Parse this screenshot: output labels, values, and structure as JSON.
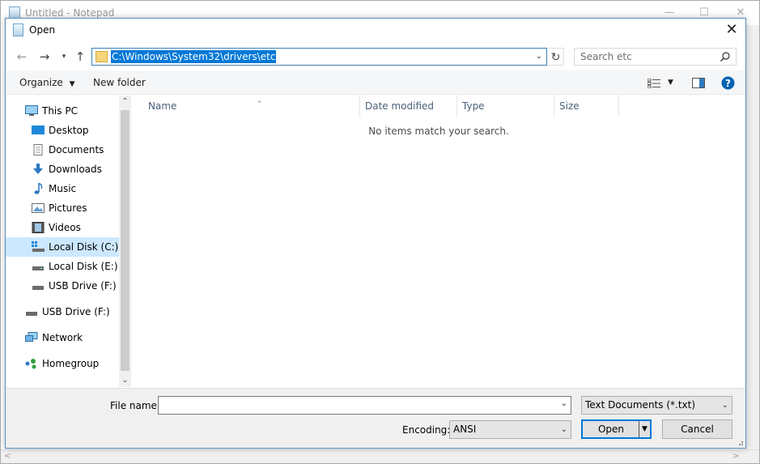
{
  "background_window": {
    "title": "Untitled - Notepad"
  },
  "dialog": {
    "title": "Open"
  },
  "address_bar": {
    "path": "C:\\Windows\\System32\\drivers\\etc"
  },
  "search": {
    "placeholder": "Search etc"
  },
  "toolbar": {
    "organize_label": "Organize",
    "new_folder_label": "New folder"
  },
  "sidebar": {
    "items": [
      {
        "label": "This PC",
        "icon": "computer-icon"
      },
      {
        "label": "Desktop",
        "icon": "desktop-icon"
      },
      {
        "label": "Documents",
        "icon": "documents-icon"
      },
      {
        "label": "Downloads",
        "icon": "downloads-icon"
      },
      {
        "label": "Music",
        "icon": "music-icon"
      },
      {
        "label": "Pictures",
        "icon": "pictures-icon"
      },
      {
        "label": "Videos",
        "icon": "videos-icon"
      },
      {
        "label": "Local Disk (C:)",
        "icon": "system-drive-icon",
        "selected": true
      },
      {
        "label": "Local Disk (E:)",
        "icon": "drive-icon"
      },
      {
        "label": "USB Drive (F:)",
        "icon": "usb-drive-icon"
      },
      {
        "label": "USB Drive (F:)",
        "icon": "usb-drive-icon"
      },
      {
        "label": "Network",
        "icon": "network-icon"
      },
      {
        "label": "Homegroup",
        "icon": "homegroup-icon"
      }
    ]
  },
  "columns": {
    "name": "Name",
    "date_modified": "Date modified",
    "type": "Type",
    "size": "Size"
  },
  "content": {
    "empty_message": "No items match your search."
  },
  "footer": {
    "file_name_label": "File name:",
    "file_name_value": "",
    "file_type_value": "Text Documents (*.txt)",
    "encoding_label": "Encoding:",
    "encoding_value": "ANSI",
    "open_label": "Open",
    "cancel_label": "Cancel"
  },
  "colors": {
    "selection": "#0078d7",
    "nav_selected": "#cce8ff",
    "help": "#0063b1",
    "folder": "#f4d57a"
  }
}
